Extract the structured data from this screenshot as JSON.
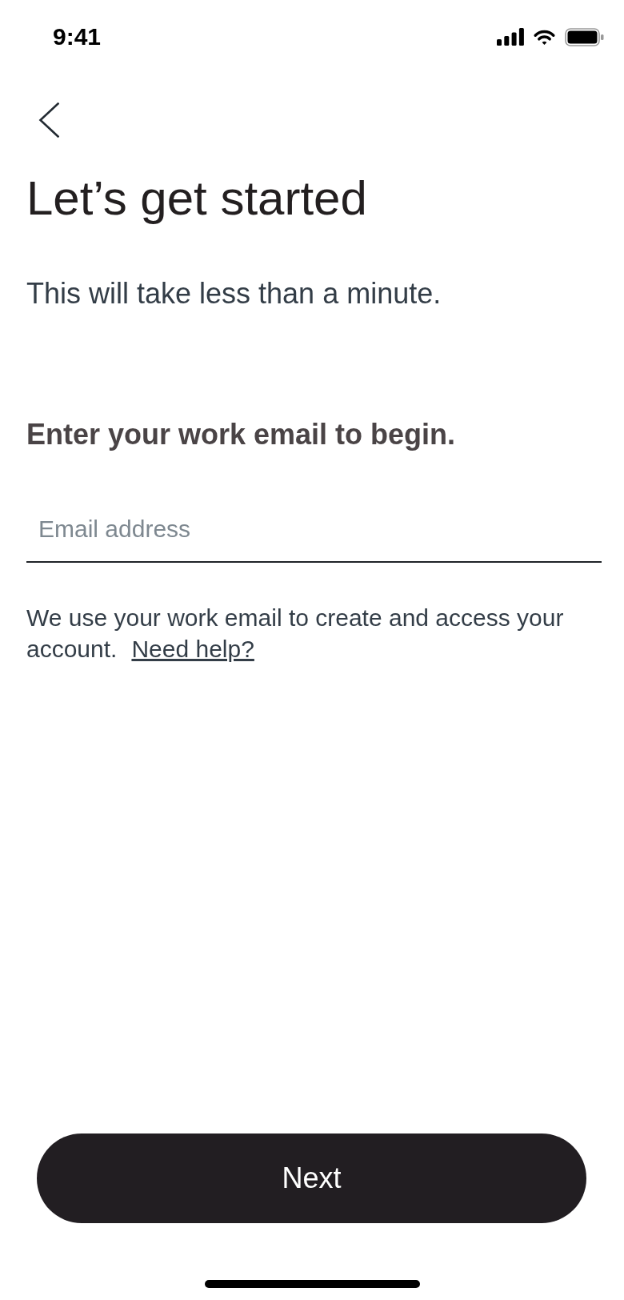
{
  "status_bar": {
    "time": "9:41"
  },
  "header": {
    "title": "Let’s get started",
    "subtitle": "This will take less than a minute."
  },
  "form": {
    "prompt": "Enter your work email to begin.",
    "email_field": {
      "placeholder": "Email address"
    },
    "helper_text": "We use your work email to create and access your account.",
    "help_link": "Need help?"
  },
  "primary_button": {
    "label": "Next"
  }
}
